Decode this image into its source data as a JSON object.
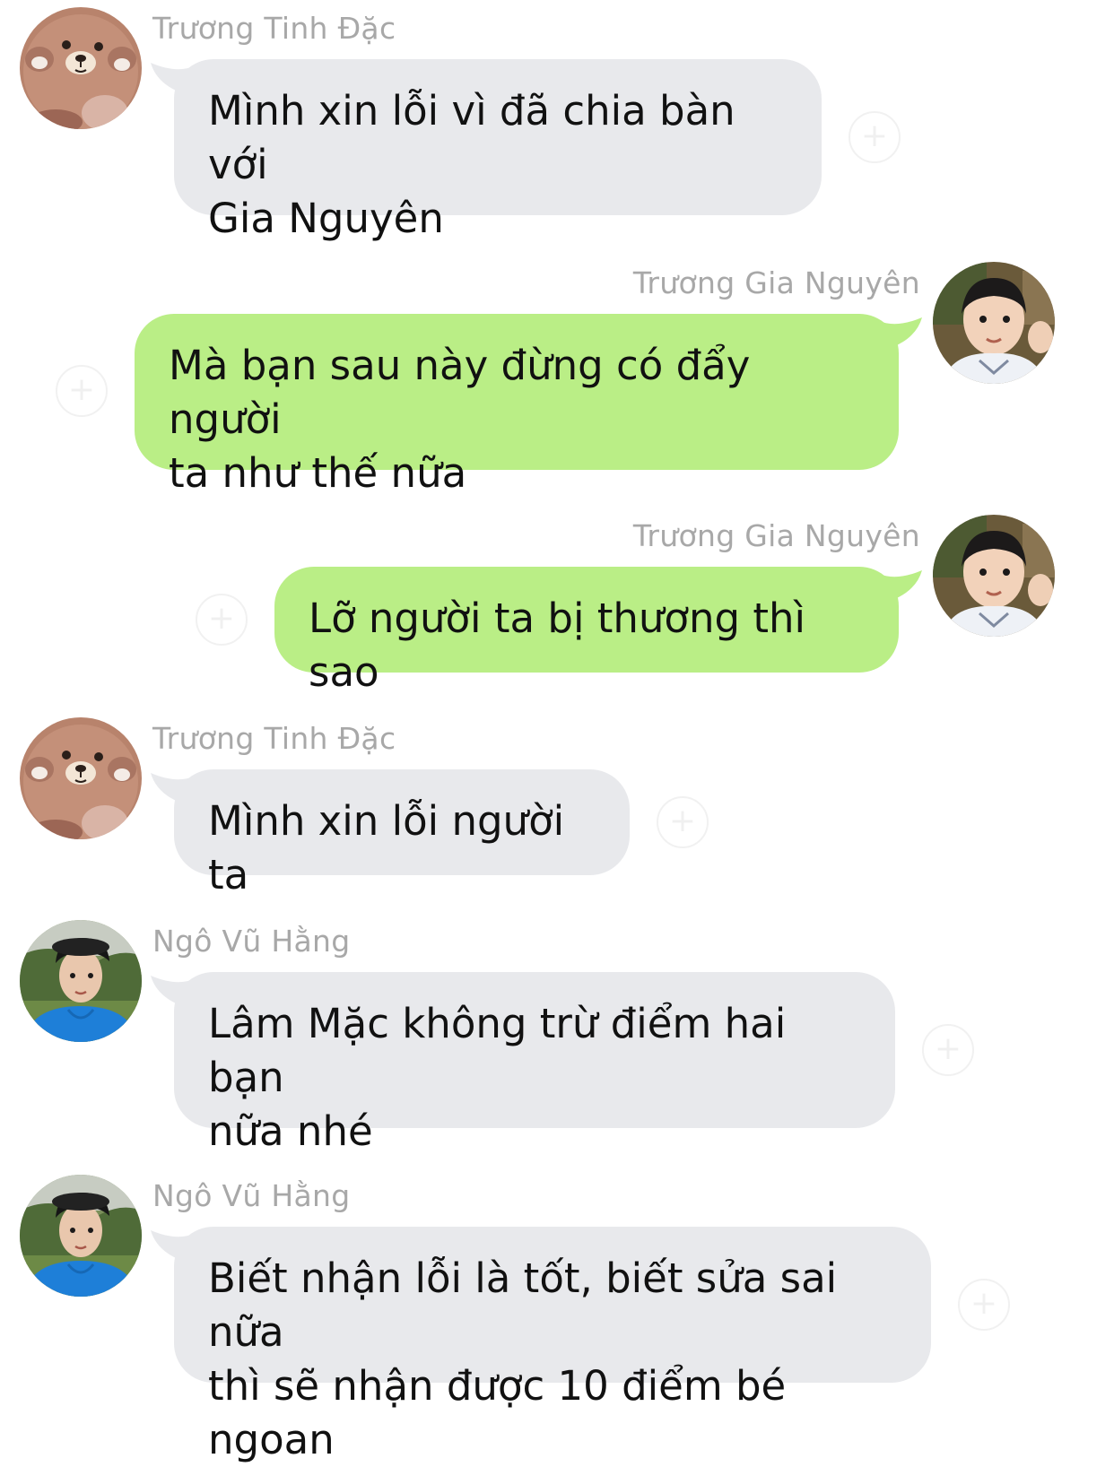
{
  "conversation": {
    "messages": [
      {
        "sender": "Trương Tinh Đặc",
        "text": "Mình xin lỗi vì đã chia bàn với\nGia Nguyên",
        "side": "incoming",
        "avatar": "bear-plush-avatar"
      },
      {
        "sender": "Trương Gia Nguyên",
        "text": "Mà bạn sau này đừng có đẩy người\nta như thế nữa",
        "side": "outgoing",
        "avatar": "child-photo-avatar"
      },
      {
        "sender": "Trương Gia Nguyên",
        "text": "Lỡ người ta bị thương thì sao",
        "side": "outgoing",
        "avatar": "child-photo-avatar"
      },
      {
        "sender": "Trương Tinh Đặc",
        "text": "Mình xin lỗi người ta",
        "side": "incoming",
        "avatar": "bear-plush-avatar"
      },
      {
        "sender": "Ngô Vũ Hằng",
        "text": "Lâm Mặc không trừ điểm hai bạn\nnữa nhé",
        "side": "incoming",
        "avatar": "young-man-photo-avatar"
      },
      {
        "sender": "Ngô Vũ Hằng",
        "text": "Biết nhận lỗi là tốt, biết sửa sai nữa\nthì sẽ nhận được 10 điểm bé ngoan",
        "side": "incoming",
        "avatar": "young-man-photo-avatar"
      }
    ]
  },
  "colors": {
    "incoming_bubble": "#e8e9ec",
    "outgoing_bubble": "#baee86",
    "sender_name": "#a8a8a8"
  },
  "icons": {
    "reaction": "add-reaction-icon"
  }
}
